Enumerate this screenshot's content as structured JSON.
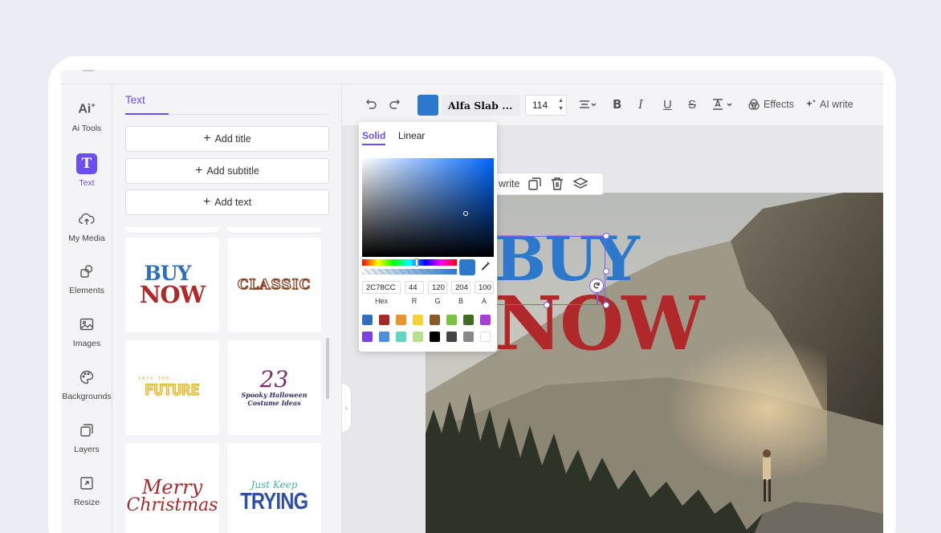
{
  "rail": [
    {
      "label": "Ai Tools",
      "icon": "ai-tools-icon"
    },
    {
      "label": "Text",
      "icon": "text-icon",
      "active": true
    },
    {
      "label": "My Media",
      "icon": "cloud-upload-icon"
    },
    {
      "label": "Elements",
      "icon": "shapes-icon"
    },
    {
      "label": "Images",
      "icon": "image-icon"
    },
    {
      "label": "Backgrounds",
      "icon": "palette-icon"
    },
    {
      "label": "Layers",
      "icon": "layers-icon"
    },
    {
      "label": "Resize",
      "icon": "resize-icon"
    }
  ],
  "panel": {
    "tab": "Text",
    "add_title": "Add title",
    "add_subtitle": "Add subtitle",
    "add_text": "Add text",
    "templates": {
      "buy": "BUY",
      "now": "NOW",
      "classic": "CLASSIC",
      "future_small": "INTO THE",
      "future": "FUTURE",
      "num": "23",
      "spooky1": "Spooky Halloween",
      "spooky2": "Costume Ideas",
      "merry": "Merry",
      "christmas": "Christmas",
      "just_keep": "Just Keep",
      "trying": "TRYING"
    }
  },
  "toolbar": {
    "font": "Alfa Slab ...",
    "size": "114",
    "effects": "Effects",
    "ai_write": "AI write",
    "color": "#2C78CC"
  },
  "context_bar": {
    "write": "write"
  },
  "canvas": {
    "line1": "BUY",
    "line2": "NOW"
  },
  "picker": {
    "tab_solid": "Solid",
    "tab_linear": "Linear",
    "hex": "2C78CC",
    "r": "44",
    "g": "120",
    "b": "204",
    "a": "100",
    "labels": {
      "hex": "Hex",
      "r": "R",
      "g": "G",
      "b": "B",
      "a": "A"
    },
    "palette": [
      "#2C6FC0",
      "#A52A2A",
      "#E8952E",
      "#F2D23A",
      "#8A5A2B",
      "#7CC242",
      "#3F6B22",
      "#A63FD9",
      "#7B3FE4",
      "#4A8FE0",
      "#5DD8C0",
      "#B8E08A",
      "#000000",
      "#444444",
      "#888888",
      "#FFFFFF"
    ]
  }
}
